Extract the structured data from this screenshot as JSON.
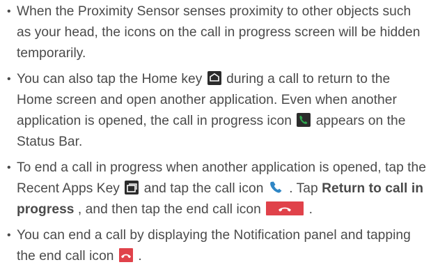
{
  "bullets": [
    {
      "text": "When the Proximity Sensor senses proximity to other objects such as your head, the icons on the call in progress screen will be hidden temporarily."
    },
    {
      "text_1": "You can also tap the Home key",
      "home_icon": "home-key-icon",
      "text_2": "during a call to return to the Home screen and open another application. Even when another application is opened, the call in progress icon",
      "call_icon": "call-in-progress-icon",
      "text_3": "appears on the Status Bar."
    },
    {
      "text_1": "To end a call in progress when another application is opened, tap the Recent Apps Key",
      "recent_icon": "recent-apps-key-icon",
      "text_2": "and tap the call icon",
      "phone_icon": "phone-icon",
      "text_3": ". Tap",
      "bold_1": "Return to call in progress",
      "text_4": ", and then tap the end call icon",
      "end_call_icon": "end-call-button-icon",
      "text_5": "."
    },
    {
      "text_1": "You can end a call by displaying the Notification panel and tapping the end call icon",
      "end_call_small_icon": "end-call-small-icon",
      "text_2": "."
    }
  ],
  "colors": {
    "text": "#4a4a4a",
    "icon_dark": "#2c2c2c",
    "call_green": "#2fa84f",
    "phone_blue": "#2f86c5",
    "end_red": "#e0424a"
  }
}
